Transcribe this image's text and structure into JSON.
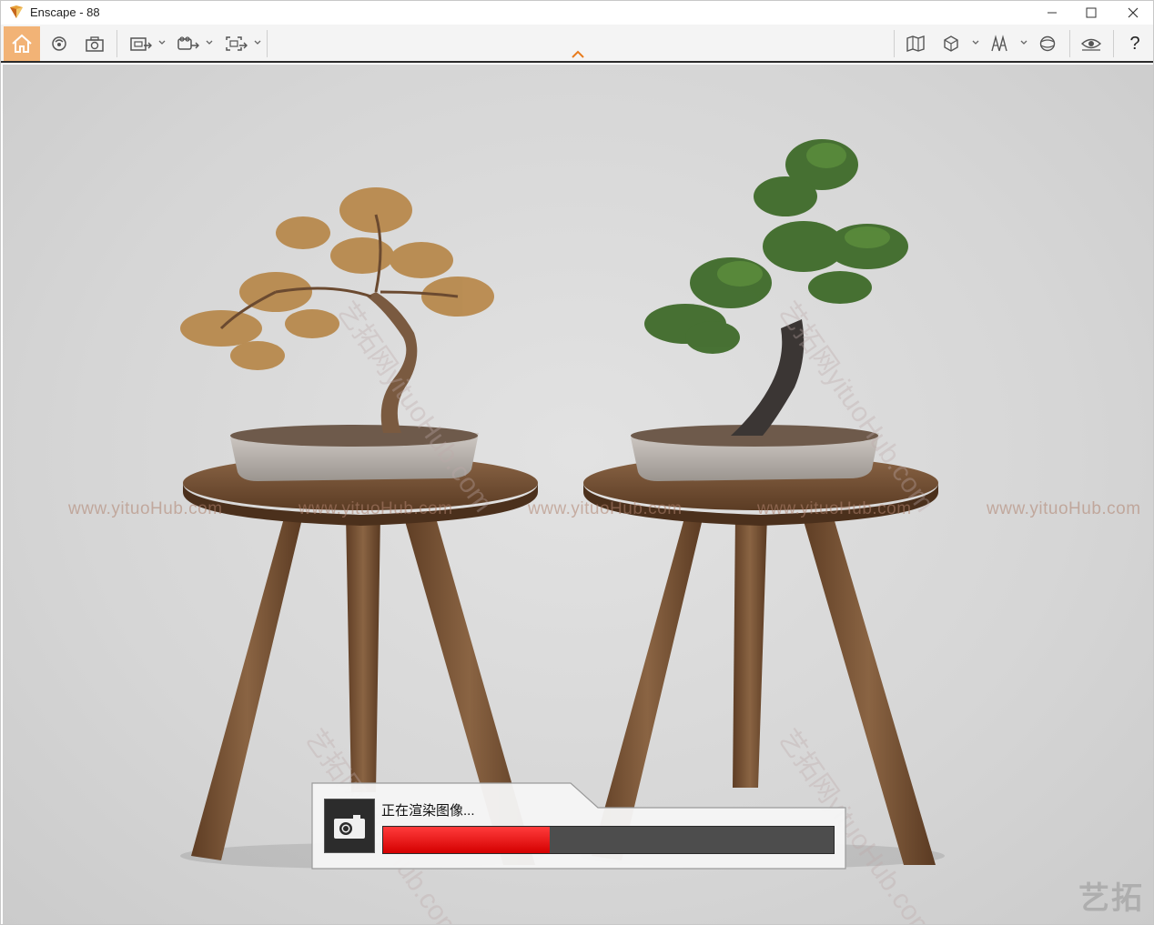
{
  "window": {
    "title": "Enscape - 88",
    "controls": [
      "minimize",
      "maximize",
      "close"
    ]
  },
  "toolbar": {
    "left_tools": [
      {
        "name": "home-icon",
        "active": true
      },
      {
        "name": "orbit-icon"
      },
      {
        "name": "screenshot-icon"
      },
      {
        "name": "render-export-icon",
        "dropdown": true
      },
      {
        "name": "video-export-icon",
        "dropdown": true
      },
      {
        "name": "panorama-export-icon",
        "dropdown": true
      }
    ],
    "right_tools": [
      {
        "name": "map-icon"
      },
      {
        "name": "cube-view-icon",
        "dropdown": true
      },
      {
        "name": "assets-icon",
        "dropdown": true
      },
      {
        "name": "settings-globe-icon"
      },
      {
        "name": "eye-visual-icon"
      },
      {
        "name": "help-icon",
        "label": "?"
      }
    ],
    "accent_color": "#e87c1e"
  },
  "viewport": {
    "watermark_text": "www.yituoHub.com",
    "watermark_diagonal": "艺拓网yituoHub.com",
    "corner_logo": "艺拓"
  },
  "render": {
    "status_label": "正在渲染图像...",
    "progress": 0.37,
    "progress_color": "#e02020"
  }
}
